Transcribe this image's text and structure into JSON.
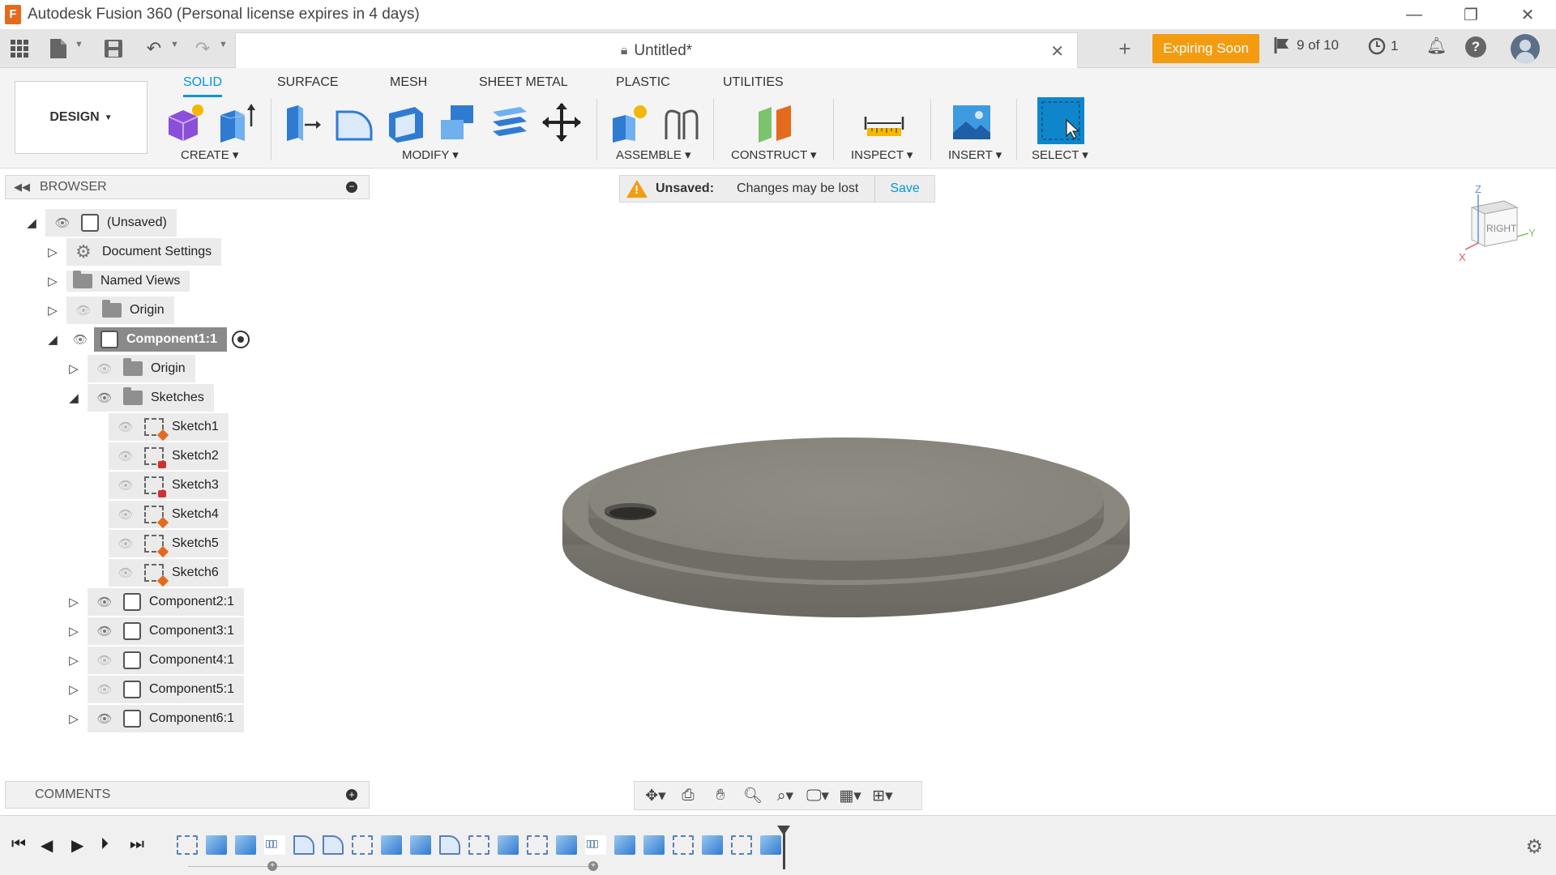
{
  "window": {
    "title": "Autodesk Fusion 360 (Personal license expires in 4 days)",
    "logo_letter": "F",
    "minimize": "—",
    "restore": "❐",
    "close": "✕"
  },
  "appbar": {
    "document_title": "Untitled*",
    "expiring_label": "Expiring Soon",
    "jobs_label": "9 of 10",
    "clock_count": "1"
  },
  "ribbon": {
    "workspace": "DESIGN",
    "tabs": [
      "SOLID",
      "SURFACE",
      "MESH",
      "SHEET METAL",
      "PLASTIC",
      "UTILITIES"
    ],
    "active_tab": "SOLID",
    "groups": [
      "CREATE",
      "MODIFY",
      "ASSEMBLE",
      "CONSTRUCT",
      "INSPECT",
      "INSERT",
      "SELECT"
    ]
  },
  "browser": {
    "title": "BROWSER",
    "root": "(Unsaved)",
    "items": {
      "document_settings": "Document Settings",
      "named_views": "Named Views",
      "origin": "Origin",
      "component1": "Component1:1",
      "comp1_origin": "Origin",
      "sketches": "Sketches",
      "sketch1": "Sketch1",
      "sketch2": "Sketch2",
      "sketch3": "Sketch3",
      "sketch4": "Sketch4",
      "sketch5": "Sketch5",
      "sketch6": "Sketch6",
      "component2": "Component2:1",
      "component3": "Component3:1",
      "component4": "Component4:1",
      "component5": "Component5:1",
      "component6": "Component6:1"
    }
  },
  "banner": {
    "title": "Unsaved:",
    "message": "Changes may be lost",
    "save": "Save"
  },
  "viewcube": {
    "face": "RIGHT",
    "axis_z": "Z",
    "axis_y": "Y",
    "axis_x": "X"
  },
  "comments": {
    "title": "COMMENTS"
  },
  "colors": {
    "accent": "#0696d7",
    "expiring": "#f39c12",
    "model": "#8a877e",
    "selected_row": "#8a8a8a"
  }
}
